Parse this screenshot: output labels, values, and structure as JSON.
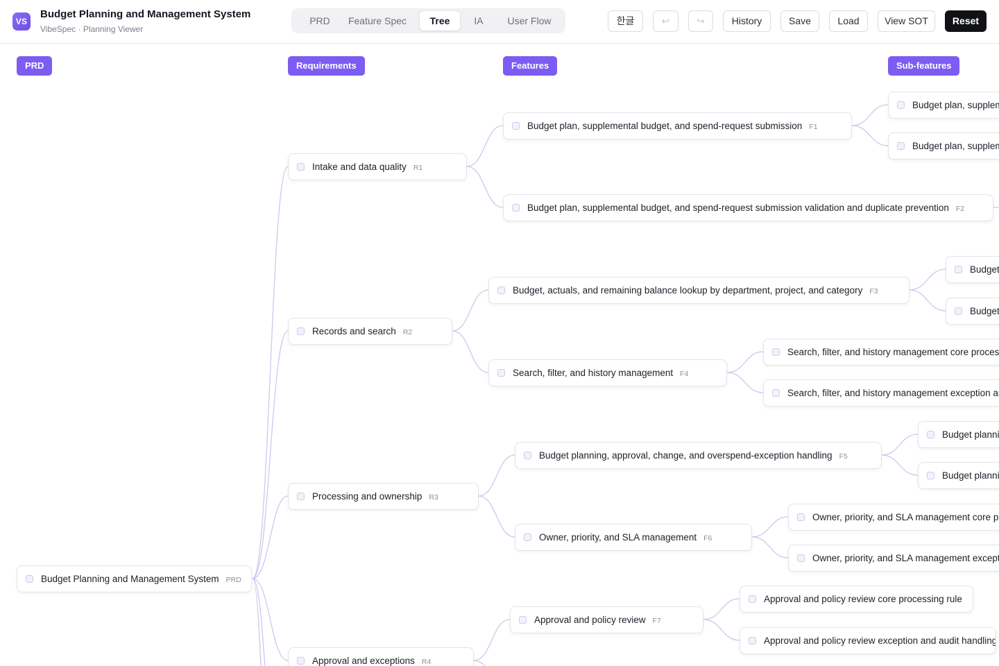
{
  "app": {
    "logo": "VS",
    "title": "Budget Planning and Management System",
    "subtitle": "VibeSpec · Planning Viewer"
  },
  "tabs": [
    {
      "label": "PRD",
      "active": false
    },
    {
      "label": "Feature Spec",
      "active": false
    },
    {
      "label": "Tree",
      "active": true
    },
    {
      "label": "IA",
      "active": false
    },
    {
      "label": "User Flow",
      "active": false
    }
  ],
  "toolbar": {
    "language": "한글",
    "undo_icon": "↩",
    "redo_icon": "↪",
    "history": "History",
    "save": "Save",
    "load": "Load",
    "view_sot": "View SOT",
    "reset": "Reset"
  },
  "columns": {
    "prd": "PRD",
    "requirements": "Requirements",
    "features": "Features",
    "subfeatures": "Sub-features"
  },
  "colors": {
    "accent": "#7c5cf2",
    "edge": "#cfc6ee",
    "reset_button": "#111216"
  },
  "tree": {
    "root": {
      "label": "Budget Planning and Management System",
      "code": "PRD"
    },
    "requirements": [
      {
        "label": "Intake and data quality",
        "code": "R1"
      },
      {
        "label": "Records and search",
        "code": "R2"
      },
      {
        "label": "Processing and ownership",
        "code": "R3"
      },
      {
        "label": "Approval and exceptions",
        "code": "R4"
      }
    ],
    "features": [
      {
        "label": "Budget plan, supplemental budget, and spend-request submission",
        "code": "F1"
      },
      {
        "label": "Budget plan, supplemental budget, and spend-request submission validation and duplicate prevention",
        "code": "F2"
      },
      {
        "label": "Budget, actuals, and remaining balance lookup by department, project, and category",
        "code": "F3"
      },
      {
        "label": "Search, filter, and history management",
        "code": "F4"
      },
      {
        "label": "Budget planning, approval, change, and overspend-exception handling",
        "code": "F5"
      },
      {
        "label": "Owner, priority, and SLA management",
        "code": "F6"
      },
      {
        "label": "Approval and policy review",
        "code": "F7"
      }
    ],
    "subfeatures": [
      {
        "label": "Budget plan, suppleme"
      },
      {
        "label": "Budget plan, suppleme"
      },
      {
        "label": "Budget,"
      },
      {
        "label": "Budget,"
      },
      {
        "label": "Search, filter, and history management core processing"
      },
      {
        "label": "Search, filter, and history management exception and"
      },
      {
        "label": "Budget plannir"
      },
      {
        "label": "Budget plannir"
      },
      {
        "label": "Owner, priority, and SLA management core proc"
      },
      {
        "label": "Owner, priority, and SLA management exceptior"
      },
      {
        "label": "Approval and policy review core processing rule"
      },
      {
        "label": "Approval and policy review exception and audit handling"
      }
    ]
  }
}
